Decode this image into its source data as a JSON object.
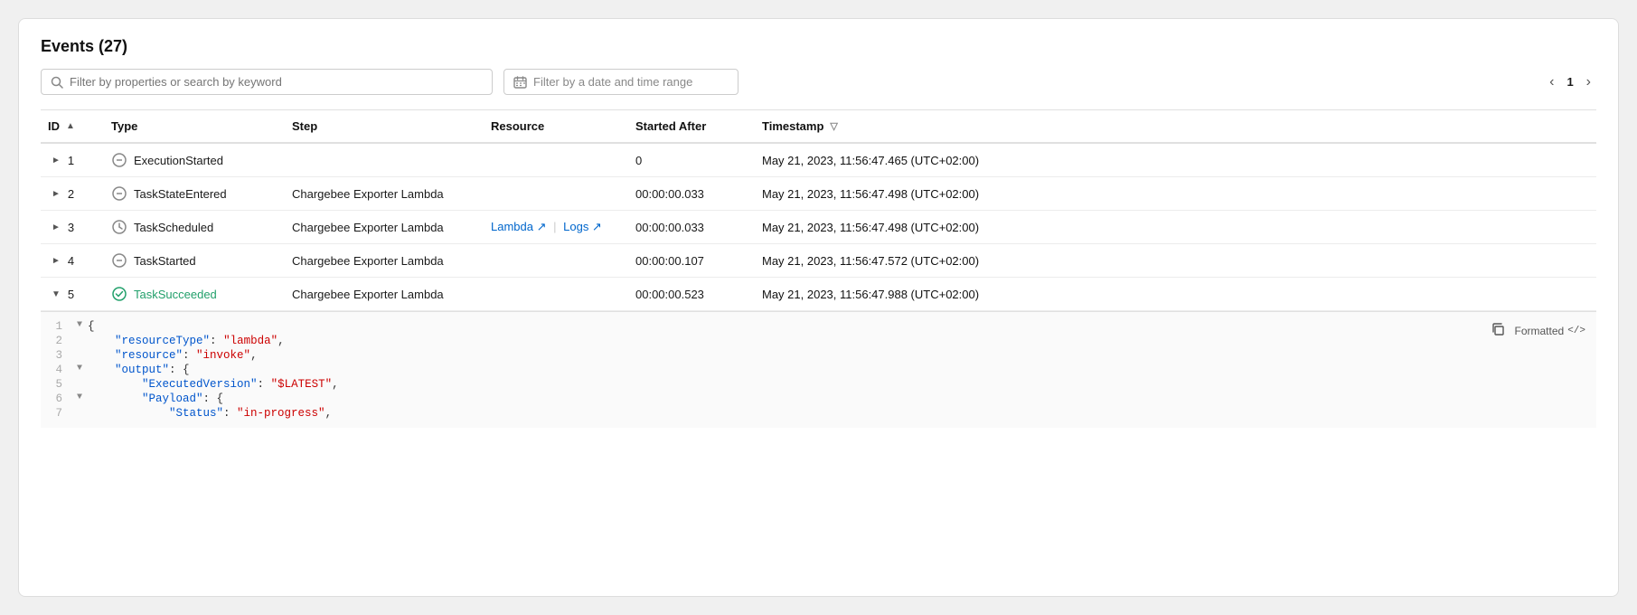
{
  "header": {
    "title": "Events (27)"
  },
  "toolbar": {
    "search_placeholder": "Filter by properties or search by keyword",
    "date_placeholder": "Filter by a date and time range",
    "page_current": "1"
  },
  "table": {
    "columns": [
      {
        "id": "id",
        "label": "ID",
        "sortable": true,
        "sort_dir": "asc"
      },
      {
        "id": "type",
        "label": "Type",
        "sortable": false
      },
      {
        "id": "step",
        "label": "Step",
        "sortable": false
      },
      {
        "id": "resource",
        "label": "Resource",
        "sortable": false
      },
      {
        "id": "started_after",
        "label": "Started After",
        "sortable": false
      },
      {
        "id": "timestamp",
        "label": "Timestamp",
        "sortable": true,
        "sort_dir": "desc"
      }
    ],
    "rows": [
      {
        "id": 1,
        "expanded": false,
        "type_icon": "circle-dash",
        "type": "ExecutionStarted",
        "type_class": "normal",
        "step": "",
        "resource": "",
        "resource_link": null,
        "logs_link": null,
        "started_after": "0",
        "timestamp": "May 21, 2023, 11:56:47.465 (UTC+02:00)"
      },
      {
        "id": 2,
        "expanded": false,
        "type_icon": "circle-dash",
        "type": "TaskStateEntered",
        "type_class": "normal",
        "step": "Chargebee Exporter Lambda",
        "resource": "",
        "resource_link": null,
        "logs_link": null,
        "started_after": "00:00:00.033",
        "timestamp": "May 21, 2023, 11:56:47.498 (UTC+02:00)"
      },
      {
        "id": 3,
        "expanded": false,
        "type_icon": "circle-clock",
        "type": "TaskScheduled",
        "type_class": "normal",
        "step": "Chargebee Exporter Lambda",
        "resource": "Lambda",
        "resource_link": "#",
        "logs_link": "#",
        "started_after": "00:00:00.033",
        "timestamp": "May 21, 2023, 11:56:47.498 (UTC+02:00)"
      },
      {
        "id": 4,
        "expanded": false,
        "type_icon": "circle-dash",
        "type": "TaskStarted",
        "type_class": "normal",
        "step": "Chargebee Exporter Lambda",
        "resource": "",
        "resource_link": null,
        "logs_link": null,
        "started_after": "00:00:00.107",
        "timestamp": "May 21, 2023, 11:56:47.572 (UTC+02:00)"
      },
      {
        "id": 5,
        "expanded": true,
        "type_icon": "circle-check",
        "type": "TaskSucceeded",
        "type_class": "success",
        "step": "Chargebee Exporter Lambda",
        "resource": "",
        "resource_link": null,
        "logs_link": null,
        "started_after": "00:00:00.523",
        "timestamp": "May 21, 2023, 11:56:47.988 (UTC+02:00)"
      }
    ]
  },
  "json_viewer": {
    "lines": [
      {
        "num": 1,
        "toggle": "▼",
        "indent": 0,
        "html": "json-brace-open",
        "content": "{"
      },
      {
        "num": 2,
        "toggle": " ",
        "indent": 1,
        "key": "resourceType",
        "value": "lambda",
        "comma": true
      },
      {
        "num": 3,
        "toggle": " ",
        "indent": 1,
        "key": "resource",
        "value": "invoke",
        "comma": true
      },
      {
        "num": 4,
        "toggle": "▼",
        "indent": 1,
        "key": "output",
        "value": "{",
        "is_obj": true
      },
      {
        "num": 5,
        "toggle": " ",
        "indent": 2,
        "key": "ExecutedVersion",
        "value": "$LATEST",
        "comma": true
      },
      {
        "num": 6,
        "toggle": "▼",
        "indent": 2,
        "key": "Payload",
        "value": "{",
        "is_obj": true
      },
      {
        "num": 7,
        "toggle": " ",
        "indent": 3,
        "key": "Status",
        "value": "in-progress",
        "comma": true
      }
    ],
    "copy_label": "📋",
    "formatted_label": "Formatted",
    "formatted_icon": "</>"
  }
}
